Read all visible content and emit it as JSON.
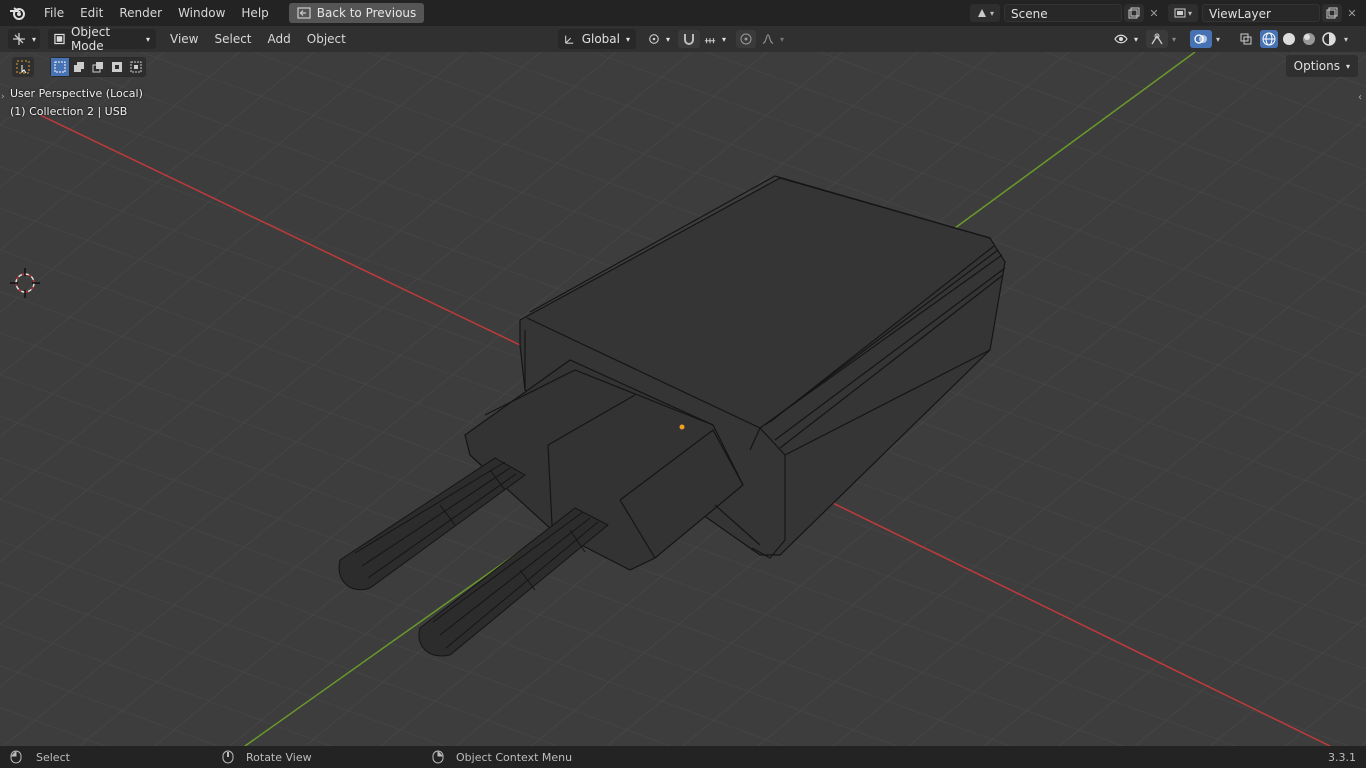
{
  "topbar": {
    "menus": [
      "File",
      "Edit",
      "Render",
      "Window",
      "Help"
    ],
    "back_label": "Back to Previous",
    "scene_name": "Scene",
    "view_layer": "ViewLayer"
  },
  "header": {
    "mode_label": "Object Mode",
    "menus": [
      "View",
      "Select",
      "Add",
      "Object"
    ],
    "orientation": "Global",
    "options_label": "Options"
  },
  "viewport": {
    "view_name": "User Perspective (Local)",
    "collection_info": "(1) Collection 2 | USB"
  },
  "statusbar": {
    "select_label": "Select",
    "rotate_label": "Rotate View",
    "context_label": "Object Context Menu",
    "version": "3.3.1"
  },
  "colors": {
    "accent": "#4772b3",
    "x_axis": "#c03a3a",
    "y_axis": "#6a9a2a",
    "origin_dot": "#f0a020"
  }
}
